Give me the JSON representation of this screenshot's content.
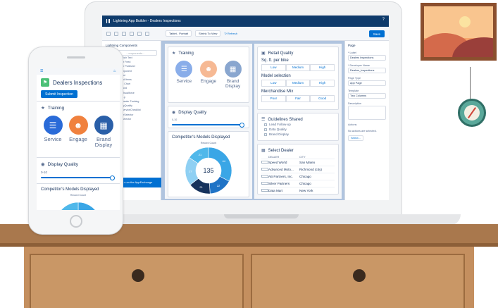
{
  "app": {
    "window_title": "Lightning App Builder - Dealers Inspections",
    "save_label": "Save",
    "device_select": "Tablet - Portrait",
    "zoom_select": "Shrink To View",
    "refresh_label": "Refresh"
  },
  "left_panel": {
    "header": "Lightning Components",
    "search_placeholder": "...omponents...",
    "components": [
      "",
      "Rich Text",
      "er Feed",
      "er Publisher",
      "mponent",
      "",
      "ent",
      "",
      "ed Items",
      "rt Chart",
      "cord",
      "Visualforce",
      "",
      "...p",
      "Dealer Training",
      "nyQuality",
      "ServiceChecklist",
      "erSelector",
      "Selector"
    ],
    "appexchange_label": "...s on the AppExchange"
  },
  "right_panel": {
    "title": "Page",
    "label_label": "* Label",
    "label_value": "Dealers Inspections",
    "dev_name_label": "* Developer Name",
    "dev_name_value": "Dealers_Inspections",
    "page_type_label": "Page Type",
    "page_type_value": "App Page",
    "template_label": "Template",
    "template_value": "Two Columns",
    "description_label": "Description",
    "actions_label": "Actions",
    "actions_empty": "No actions are selected.",
    "select_btn": "Select..."
  },
  "training": {
    "title": "Training",
    "tiles": [
      {
        "label": "Service",
        "color": "#2a6bd8"
      },
      {
        "label": "Engage",
        "color": "#f0813e"
      },
      {
        "label": "Brand Display",
        "color": "#2a5fa8"
      }
    ]
  },
  "display_quality": {
    "title": "Display Quality",
    "range_label": "0-10",
    "level": 1.0
  },
  "competitor": {
    "title": "Competitor's Models Displayed",
    "subtitle": "Record Count",
    "total": "135"
  },
  "chart_data": {
    "type": "pie",
    "title": "Competitor's Models Displayed",
    "subtitle": "Record Count",
    "center_label": "135",
    "series": [
      {
        "label": "",
        "value": 44,
        "color": "#3aa6e6"
      },
      {
        "label": "",
        "value": 22,
        "color": "#1f73c6"
      },
      {
        "label": "",
        "value": 21,
        "color": "#16325c"
      },
      {
        "label": "",
        "value": 27,
        "color": "#8fd0f3"
      },
      {
        "label": "",
        "value": 21,
        "color": "#50b8ea"
      }
    ],
    "visible_labels": [
      "44",
      "22",
      "21",
      "27",
      "21"
    ]
  },
  "retail_quality": {
    "title": "Retail Quality",
    "rows": [
      {
        "label": "Sq. ft. per bike",
        "options": [
          "Low",
          "Medium",
          "High"
        ]
      },
      {
        "label": "Model selection",
        "options": [
          "Low",
          "Medium",
          "High"
        ]
      },
      {
        "label": "Merchandise Mix",
        "options": [
          "Poor",
          "Fair",
          "Good"
        ]
      }
    ]
  },
  "guidelines": {
    "title": "Guidelines Shared",
    "items": [
      "Lead Follow-up",
      "Data Quality",
      "Brand Display"
    ]
  },
  "select_dealer": {
    "title": "Select Dealer",
    "headers": [
      "",
      "DEALER",
      "CITY"
    ],
    "rows": [
      {
        "dealer": "Speed World",
        "city": "San Mateo"
      },
      {
        "dealer": "Advanced Moto...",
        "city": "Richmond (city)"
      },
      {
        "dealer": "AB Partners, Inc.",
        "city": "Chicago"
      },
      {
        "dealer": "Silver Partners",
        "city": "Chicago"
      },
      {
        "dealer": "Data Mart",
        "city": "New York"
      }
    ]
  },
  "phone": {
    "app_title": "Dealers Inspections",
    "submit_label": "Submit Inspection",
    "training_title": "Training",
    "dq_title": "Display Quality",
    "dq_range": "0-10",
    "competitor_title": "Competitor's Models Displayed",
    "competitor_subtitle": "Record Count"
  }
}
